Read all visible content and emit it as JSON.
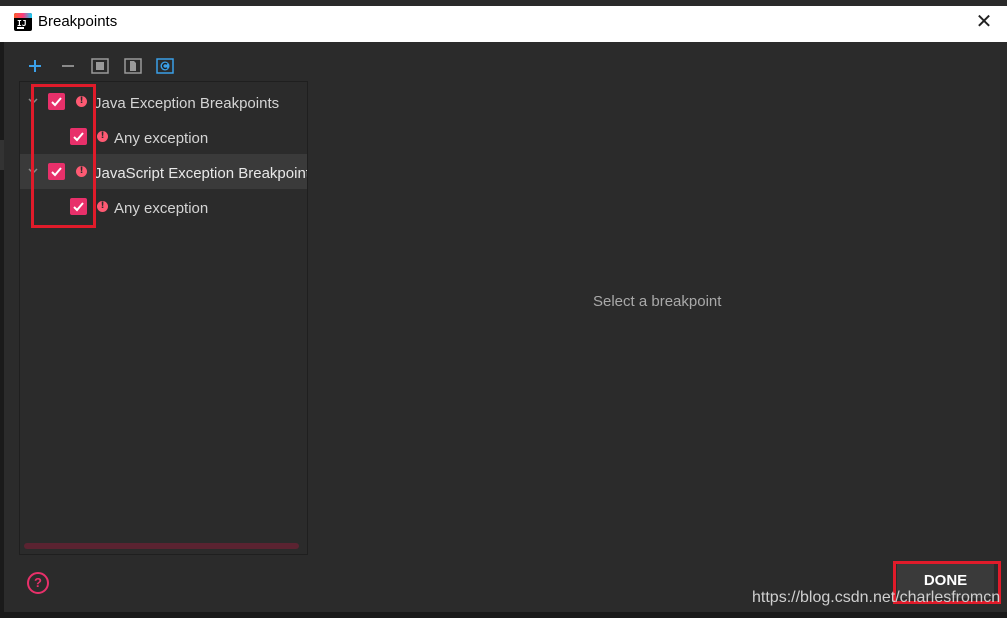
{
  "window": {
    "title": "Breakpoints",
    "close_symbol": "✕"
  },
  "toolbar": {
    "add_symbol": "+",
    "remove_symbol": "−",
    "icons": [
      "add-icon",
      "remove-icon",
      "group-by-package-icon",
      "group-by-file-icon",
      "group-by-class-icon"
    ]
  },
  "tree": {
    "items": [
      {
        "label": "Java Exception Breakpoints",
        "checked": true,
        "expanded": true,
        "level": 0
      },
      {
        "label": "Any exception",
        "checked": true,
        "level": 1
      },
      {
        "label": "JavaScript Exception Breakpoints",
        "checked": true,
        "expanded": true,
        "level": 0,
        "selected": true
      },
      {
        "label": "Any exception",
        "checked": true,
        "level": 1
      }
    ]
  },
  "detail": {
    "placeholder": "Select a breakpoint"
  },
  "footer": {
    "help_symbol": "?",
    "done_label": "DONE"
  },
  "watermark": "https://blog.csdn.net/charlesfromcn",
  "colors": {
    "accent": "#e8306a",
    "warning": "#ff5a73",
    "highlight_box": "#e01b2a",
    "background": "#2b2b2b"
  }
}
